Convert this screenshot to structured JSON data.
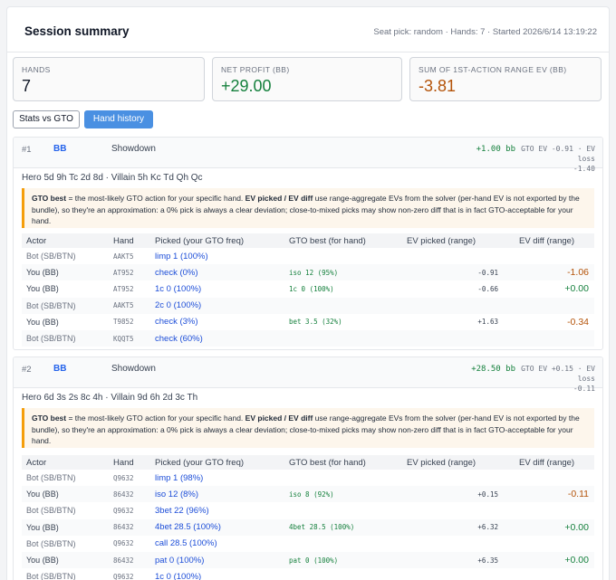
{
  "header": {
    "title": "Session summary",
    "meta": "Seat pick: random · Hands: 7 · Started 2026/6/14 13:19:22"
  },
  "cards": [
    {
      "label": "HANDS",
      "value": "7",
      "tone": "neu"
    },
    {
      "label": "NET PROFIT (BB)",
      "value": "+29.00",
      "tone": "pos"
    },
    {
      "label": "SUM OF 1ST-ACTION RANGE EV (BB)",
      "value": "-3.81",
      "tone": "neg"
    }
  ],
  "tabs": [
    {
      "label": "Stats vs GTO",
      "active": false
    },
    {
      "label": "Hand history",
      "active": true
    }
  ],
  "note": {
    "b1": "GTO best",
    "t1": " = the most-likely GTO action for your specific hand. ",
    "b2": "EV picked / EV diff",
    "t2": " use range-aggregate EVs from the solver (per-hand EV is not exported by the bundle), so they're an approximation: a 0% pick is always a clear deviation; close-to-mixed picks may show non-zero diff that is in fact GTO-acceptable for your hand."
  },
  "columns": [
    "Actor",
    "Hand",
    "Picked (your GTO freq)",
    "GTO best (for hand)",
    "EV picked (range)",
    "EV diff (range)"
  ],
  "hands": [
    {
      "num": "#1",
      "pos": "BB",
      "result": "Showdown",
      "profit": "+1.00 bb",
      "gto_line1": "GTO EV -0.91 · EV loss",
      "gto_line2": "-1.40",
      "cards": "Hero 5d 9h Tc 2d 8d · Villain 5h Kc Td Qh Qc",
      "rows": [
        {
          "actor": "Bot (SB/BTN)",
          "hand": "AAKT5",
          "picked": "limp 1 (100%)",
          "gto": "",
          "evp": "",
          "evd": "",
          "tone": ""
        },
        {
          "actor": "You (BB)",
          "hand": "AT952",
          "picked": "check (0%)",
          "gto": "iso 12 (95%)",
          "evp": "-0.91",
          "evd": "-1.06",
          "tone": "neg"
        },
        {
          "actor": "You (BB)",
          "hand": "AT952",
          "picked": "1c 0 (100%)",
          "gto": "1c 0 (100%)",
          "evp": "-0.66",
          "evd": "+0.00",
          "tone": "pos"
        },
        {
          "actor": "Bot (SB/BTN)",
          "hand": "AAKT5",
          "picked": "2c 0 (100%)",
          "gto": "",
          "evp": "",
          "evd": "",
          "tone": ""
        },
        {
          "actor": "You (BB)",
          "hand": "T9852",
          "picked": "check (3%)",
          "gto": "bet 3.5 (32%)",
          "evp": "+1.63",
          "evd": "-0.34",
          "tone": "neg"
        },
        {
          "actor": "Bot (SB/BTN)",
          "hand": "KQQT5",
          "picked": "check (60%)",
          "gto": "",
          "evp": "",
          "evd": "",
          "tone": ""
        }
      ]
    },
    {
      "num": "#2",
      "pos": "BB",
      "result": "Showdown",
      "profit": "+28.50 bb",
      "gto_line1": "GTO EV +0.15 · EV loss",
      "gto_line2": "-0.11",
      "cards": "Hero 6d 3s 2s 8c 4h · Villain 9d 6h 2d 3c Th",
      "rows": [
        {
          "actor": "Bot (SB/BTN)",
          "hand": "Q9632",
          "picked": "limp 1 (98%)",
          "gto": "",
          "evp": "",
          "evd": "",
          "tone": ""
        },
        {
          "actor": "You (BB)",
          "hand": "86432",
          "picked": "iso 12 (8%)",
          "gto": "iso 8 (92%)",
          "evp": "+0.15",
          "evd": "-0.11",
          "tone": "neg"
        },
        {
          "actor": "Bot (SB/BTN)",
          "hand": "Q9632",
          "picked": "3bet 22 (96%)",
          "gto": "",
          "evp": "",
          "evd": "",
          "tone": ""
        },
        {
          "actor": "You (BB)",
          "hand": "86432",
          "picked": "4bet 28.5 (100%)",
          "gto": "4bet 28.5 (100%)",
          "evp": "+6.32",
          "evd": "+0.00",
          "tone": "pos"
        },
        {
          "actor": "Bot (SB/BTN)",
          "hand": "Q9632",
          "picked": "call 28.5 (100%)",
          "gto": "",
          "evp": "",
          "evd": "",
          "tone": ""
        },
        {
          "actor": "You (BB)",
          "hand": "86432",
          "picked": "pat 0 (100%)",
          "gto": "pat 0 (100%)",
          "evp": "+6.35",
          "evd": "+0.00",
          "tone": "pos"
        },
        {
          "actor": "Bot (SB/BTN)",
          "hand": "Q9632",
          "picked": "1c 0 (100%)",
          "gto": "",
          "evp": "",
          "evd": "",
          "tone": ""
        }
      ]
    }
  ]
}
